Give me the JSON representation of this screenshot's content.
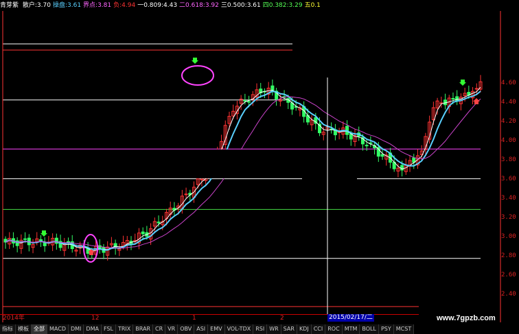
{
  "header": {
    "name": "青芽紫",
    "items": [
      {
        "label": "散户:",
        "value": "3.70",
        "color": "#ffffff"
      },
      {
        "label": "操盘:",
        "value": "3.61",
        "color": "#5ad0ff"
      },
      {
        "label": "界点:",
        "value": "3.81",
        "color": "#ff66ff"
      },
      {
        "label": "负:",
        "value": "4.94",
        "color": "#ff3333"
      },
      {
        "label": "一0.809:",
        "value": "4.43",
        "color": "#ffffff"
      },
      {
        "label": "二0.618:",
        "value": "3.92",
        "color": "#ff66ff"
      },
      {
        "label": "三0.500:",
        "value": "3.61",
        "color": "#ffffff"
      },
      {
        "label": "四0.382:",
        "value": "3.29",
        "color": "#55ff55"
      },
      {
        "label": "五0.1",
        "value": "",
        "color": "#ffff33"
      }
    ]
  },
  "yaxis": {
    "ticks": [
      "4.60",
      "4.40",
      "4.20",
      "4.00",
      "3.80",
      "3.60",
      "3.40",
      "3.20",
      "3.00",
      "2.80",
      "2.60",
      "2.40"
    ],
    "color": "#dd2222"
  },
  "timeaxis": {
    "labels": [
      "2014年",
      "12",
      "1",
      "2"
    ],
    "cursor_date": "2015/02/17/二"
  },
  "tabs": [
    "指标",
    "模板",
    "全部",
    "MACD",
    "DMI",
    "DMA",
    "FSL",
    "TRIX",
    "BRAR",
    "CR",
    "VR",
    "OBV",
    "ASI",
    "EMV",
    "VOL-TDX",
    "RSI",
    "WR",
    "SAR",
    "KDJ",
    "CCI",
    "ROC",
    "MTM",
    "BOLL",
    "PSY",
    "MCST"
  ],
  "watermark": "www.7gpzb.com",
  "chart_data": {
    "type": "candlestick",
    "ylim": [
      2.4,
      4.7
    ],
    "levels": [
      {
        "value": 4.94,
        "color": "#ff3333"
      },
      {
        "value": 4.43,
        "color": "#ffffff"
      },
      {
        "value": 3.92,
        "color": "#ff44ff"
      },
      {
        "value": 3.61,
        "color": "#ffffff"
      },
      {
        "value": 3.29,
        "color": "#44dd44"
      },
      {
        "value": 2.78,
        "color": "#ffffff"
      }
    ],
    "colors": {
      "up": "#ff3333",
      "down": "#33ff66",
      "ma_fast": "#ffffff",
      "ma_mid": "#5ad0ff",
      "ma_slow": "#cc44cc"
    }
  }
}
